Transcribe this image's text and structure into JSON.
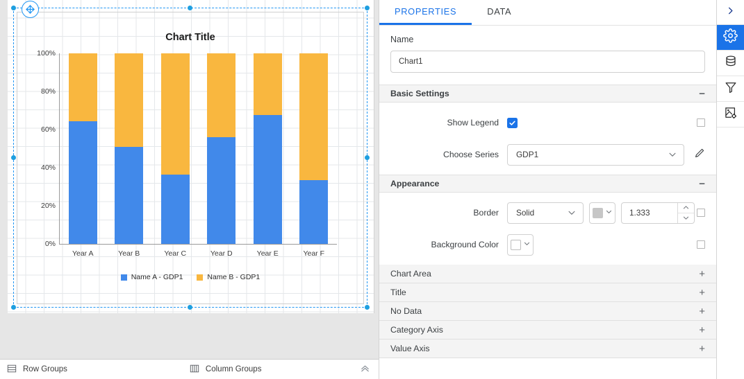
{
  "designer": {
    "move_handle_icon": "move-crosshair-icon",
    "groups_bar": {
      "row_groups_label": "Row Groups",
      "row_groups_icon": "rows-icon",
      "column_groups_label": "Column Groups",
      "column_groups_icon": "columns-icon",
      "collapse_icon": "chevron-double-up-icon"
    }
  },
  "chart_data": {
    "type": "bar",
    "stacked": "100%",
    "title": "Chart Title",
    "xlabel": "",
    "ylabel": "",
    "categories": [
      "Year A",
      "Year B",
      "Year C",
      "Year D",
      "Year E",
      "Year F"
    ],
    "ytick_labels": [
      "100%",
      "80%",
      "60%",
      "40%",
      "20%",
      "0%"
    ],
    "ytick_values": [
      100,
      80,
      60,
      40,
      20,
      0
    ],
    "ylim": [
      0,
      100
    ],
    "grid": true,
    "legend_position": "bottom",
    "series": [
      {
        "name": "Name A - GDP1",
        "color": "#4189ea",
        "values": [
          64.5,
          51.0,
          36.5,
          56.0,
          67.5,
          33.5
        ]
      },
      {
        "name": "Name B - GDP1",
        "color": "#f9b73f",
        "values": [
          35.5,
          49.0,
          63.5,
          44.0,
          32.5,
          66.5
        ]
      }
    ]
  },
  "panel": {
    "tabs": [
      {
        "label": "PROPERTIES",
        "active": true
      },
      {
        "label": "DATA",
        "active": false
      }
    ],
    "name_field": {
      "label": "Name",
      "value": "Chart1",
      "placeholder": "Name"
    },
    "sections": {
      "basic_settings": {
        "title": "Basic Settings",
        "toggle": "−",
        "show_legend": {
          "label": "Show Legend",
          "checked": true,
          "expression_checkbox": false
        },
        "choose_series": {
          "label": "Choose Series",
          "value": "GDP1",
          "chevron_icon": "chevron-down-icon",
          "edit_icon": "pencil-icon"
        }
      },
      "appearance": {
        "title": "Appearance",
        "toggle": "−",
        "border": {
          "label": "Border",
          "style_value": "Solid",
          "color_value": "#c6c6c6",
          "width_value": "1.333",
          "expression_checkbox": false,
          "chevron_icon": "chevron-down-icon",
          "spinner_up_icon": "chevron-up-icon",
          "spinner_down_icon": "chevron-down-icon"
        },
        "background_color": {
          "label": "Background Color",
          "color_value": "#ffffff",
          "expression_checkbox": false,
          "chevron_icon": "chevron-down-icon"
        }
      }
    },
    "collapsed_sections": [
      {
        "title": "Chart Area",
        "toggle": "+"
      },
      {
        "title": "Title",
        "toggle": "+"
      },
      {
        "title": "No Data",
        "toggle": "+"
      },
      {
        "title": "Category Axis",
        "toggle": "+"
      },
      {
        "title": "Value Axis",
        "toggle": "+"
      }
    ]
  },
  "rail": {
    "items": [
      {
        "icon": "chevron-right-icon",
        "active": false
      },
      {
        "icon": "gear-icon",
        "active": true
      },
      {
        "icon": "database-icon",
        "active": false
      },
      {
        "icon": "filter-funnel-icon",
        "active": false
      },
      {
        "icon": "image-settings-icon",
        "active": false
      }
    ]
  },
  "colors": {
    "accent": "#1a73e8",
    "series_a": "#4189ea",
    "series_b": "#f9b73f",
    "selection": "#2196f3"
  }
}
